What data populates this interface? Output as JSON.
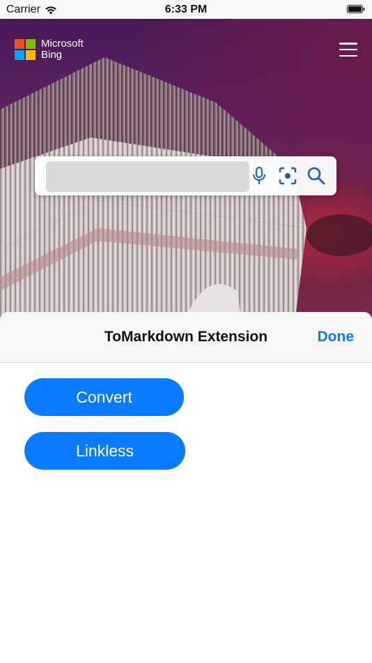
{
  "status_bar": {
    "carrier": "Carrier",
    "time": "6:33 PM",
    "wifi_icon": "wifi-icon",
    "battery_icon": "battery-icon"
  },
  "webpage": {
    "brand_line1": "Microsoft",
    "brand_line2": "Bing",
    "logo_colors": [
      "#f25022",
      "#7fba00",
      "#00a4ef",
      "#ffb900"
    ],
    "menu_icon": "hamburger-menu-icon",
    "search": {
      "value": "",
      "mic_icon": "microphone-icon",
      "visual_search_icon": "camera-search-icon",
      "search_icon": "search-icon"
    }
  },
  "sheet": {
    "title": "ToMarkdown Extension",
    "done_label": "Done",
    "buttons": [
      {
        "label": "Convert"
      },
      {
        "label": "Linkless"
      }
    ],
    "accent_color": "#0a7aff"
  }
}
